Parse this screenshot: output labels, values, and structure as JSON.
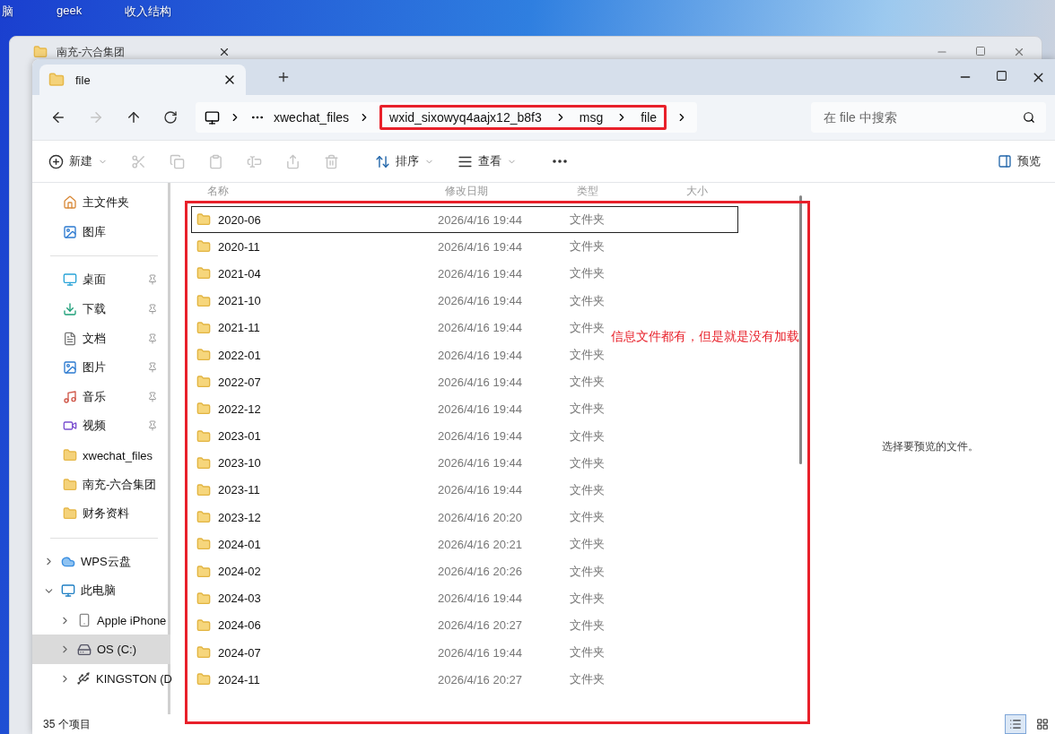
{
  "desktop": {
    "labels": [
      "脑",
      "geek",
      "收入结构"
    ]
  },
  "back_window": {
    "tab": {
      "title": "南充-六合集团"
    }
  },
  "window": {
    "tabs": [
      {
        "title": "file",
        "selected": true
      }
    ],
    "address": {
      "crumbs": [
        {
          "label": "xwechat_files",
          "highlighted": false
        },
        {
          "label": "wxid_sixowyq4aajx12_b8f3",
          "highlighted": true
        },
        {
          "label": "msg",
          "highlighted": true
        },
        {
          "label": "file",
          "highlighted": true
        }
      ]
    },
    "search": {
      "placeholder": "在 file 中搜索"
    },
    "toolbar": [
      {
        "kind": "new",
        "label": "新建",
        "disabled": false
      },
      {
        "kind": "cut",
        "disabled": true
      },
      {
        "kind": "copy",
        "disabled": true
      },
      {
        "kind": "paste",
        "disabled": true
      },
      {
        "kind": "rename",
        "disabled": true
      },
      {
        "kind": "share",
        "disabled": true
      },
      {
        "kind": "delete",
        "disabled": true
      },
      {
        "kind": "sort",
        "label": "排序",
        "disabled": false
      },
      {
        "kind": "view",
        "label": "查看",
        "disabled": false
      },
      {
        "kind": "more",
        "disabled": false
      }
    ],
    "preview_button": {
      "label": "预览"
    },
    "sidebar": {
      "sections": [
        {
          "items": [
            {
              "label": "主文件夹",
              "kind": "home",
              "pinned": false
            },
            {
              "label": "图库",
              "kind": "gallery",
              "pinned": false
            }
          ]
        },
        {
          "items": [
            {
              "label": "桌面",
              "kind": "desktop",
              "pinned": true
            },
            {
              "label": "下载",
              "kind": "download",
              "pinned": true
            },
            {
              "label": "文档",
              "kind": "documents",
              "pinned": true
            },
            {
              "label": "图片",
              "kind": "pictures",
              "pinned": true
            },
            {
              "label": "音乐",
              "kind": "music",
              "pinned": true
            },
            {
              "label": "视频",
              "kind": "videos",
              "pinned": true
            },
            {
              "label": "xwechat_files",
              "kind": "folder",
              "pinned": false
            },
            {
              "label": "南充-六合集团",
              "kind": "folder",
              "pinned": false
            },
            {
              "label": "财务资料",
              "kind": "folder",
              "pinned": false
            }
          ]
        },
        {
          "items": [
            {
              "label": "WPS云盘",
              "kind": "cloud",
              "expanded": false,
              "selected": false
            },
            {
              "label": "此电脑",
              "kind": "pc",
              "expanded": true,
              "selected": false,
              "children": [
                {
                  "label": "Apple iPhone",
                  "kind": "phone",
                  "expanded": false,
                  "selected": false
                },
                {
                  "label": "OS (C:)",
                  "kind": "drive",
                  "expanded": false,
                  "selected": true
                },
                {
                  "label": "KINGSTON (D",
                  "kind": "usb",
                  "expanded": false,
                  "selected": false
                }
              ]
            }
          ]
        }
      ]
    },
    "table": {
      "columns": [
        "名称",
        "修改日期",
        "类型",
        "大小"
      ],
      "rows": [
        {
          "name": "2020-06",
          "modified": "2026/4/16 19:44",
          "type": "文件夹",
          "selected": true
        },
        {
          "name": "2020-11",
          "modified": "2026/4/16 19:44",
          "type": "文件夹",
          "selected": false
        },
        {
          "name": "2021-04",
          "modified": "2026/4/16 19:44",
          "type": "文件夹",
          "selected": false
        },
        {
          "name": "2021-10",
          "modified": "2026/4/16 19:44",
          "type": "文件夹",
          "selected": false
        },
        {
          "name": "2021-11",
          "modified": "2026/4/16 19:44",
          "type": "文件夹",
          "selected": false
        },
        {
          "name": "2022-01",
          "modified": "2026/4/16 19:44",
          "type": "文件夹",
          "selected": false
        },
        {
          "name": "2022-07",
          "modified": "2026/4/16 19:44",
          "type": "文件夹",
          "selected": false
        },
        {
          "name": "2022-12",
          "modified": "2026/4/16 19:44",
          "type": "文件夹",
          "selected": false
        },
        {
          "name": "2023-01",
          "modified": "2026/4/16 19:44",
          "type": "文件夹",
          "selected": false
        },
        {
          "name": "2023-10",
          "modified": "2026/4/16 19:44",
          "type": "文件夹",
          "selected": false
        },
        {
          "name": "2023-11",
          "modified": "2026/4/16 19:44",
          "type": "文件夹",
          "selected": false
        },
        {
          "name": "2023-12",
          "modified": "2026/4/16 20:20",
          "type": "文件夹",
          "selected": false
        },
        {
          "name": "2024-01",
          "modified": "2026/4/16 20:21",
          "type": "文件夹",
          "selected": false
        },
        {
          "name": "2024-02",
          "modified": "2026/4/16 20:26",
          "type": "文件夹",
          "selected": false
        },
        {
          "name": "2024-03",
          "modified": "2026/4/16 19:44",
          "type": "文件夹",
          "selected": false
        },
        {
          "name": "2024-06",
          "modified": "2026/4/16 20:27",
          "type": "文件夹",
          "selected": false
        },
        {
          "name": "2024-07",
          "modified": "2026/4/16 19:44",
          "type": "文件夹",
          "selected": false
        },
        {
          "name": "2024-11",
          "modified": "2026/4/16 20:27",
          "type": "文件夹",
          "selected": false
        }
      ]
    },
    "preview_message": "选择要预览的文件。",
    "status_bar": {
      "count": "35 个项目",
      "views": [
        {
          "kind": "details",
          "selected": true
        },
        {
          "kind": "tiles",
          "selected": false
        }
      ]
    },
    "annotation": {
      "text": "信息文件都有，但是就是没有加载"
    }
  }
}
